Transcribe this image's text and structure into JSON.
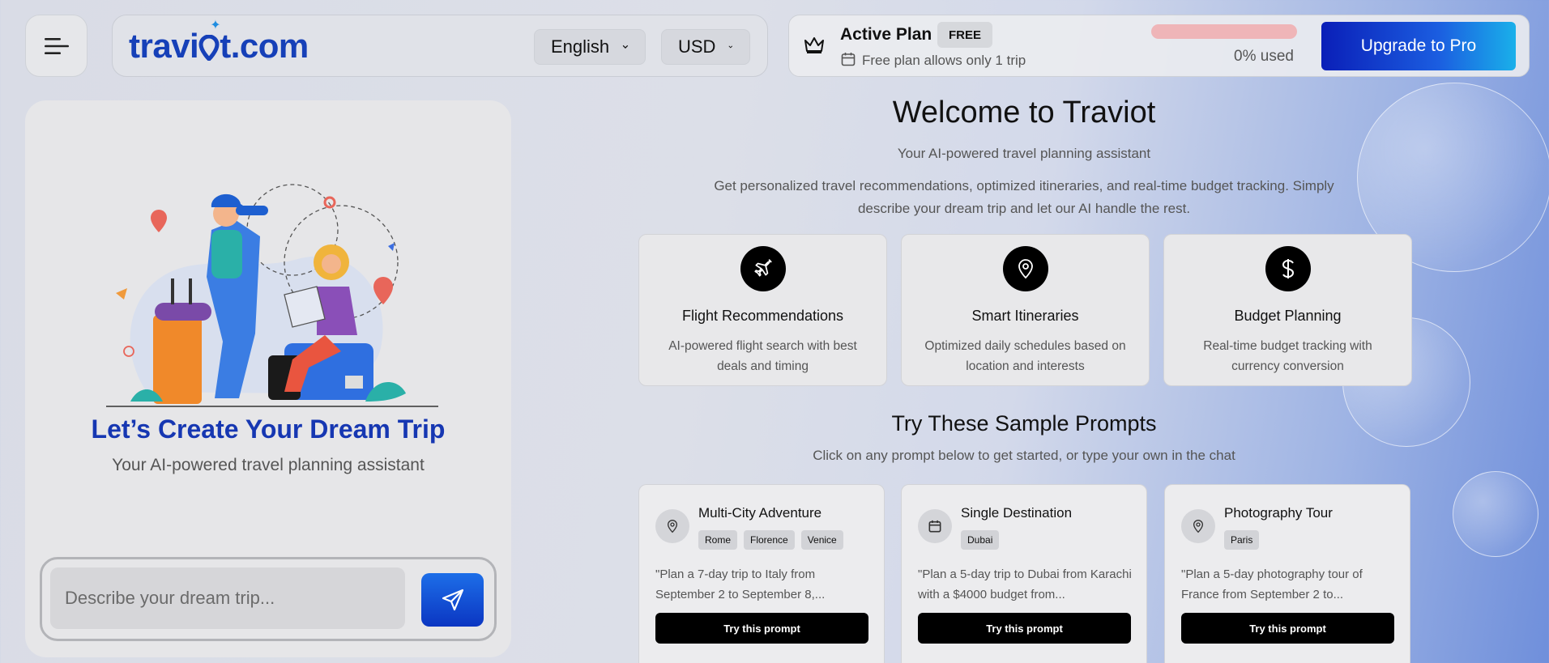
{
  "header": {
    "logo_text": "travi",
    "logo_suffix": "t.com",
    "language": "English",
    "currency": "USD"
  },
  "plan": {
    "title": "Active Plan",
    "badge": "FREE",
    "subtitle": "Free plan allows only 1 trip",
    "usage_percent": 0,
    "usage_label": "0% used",
    "upgrade_label": "Upgrade to Pro"
  },
  "left": {
    "title": "Let’s Create Your Dream Trip",
    "subtitle": "Your AI-powered travel planning assistant",
    "input_placeholder": "Describe your dream trip..."
  },
  "main": {
    "title": "Welcome to Traviot",
    "subtitle": "Your AI-powered travel planning assistant",
    "description": "Get personalized travel recommendations, optimized itineraries, and real-time budget tracking. Simply describe your dream trip and let our AI handle the rest.",
    "features": [
      {
        "icon": "plane-icon",
        "title": "Flight Recommendations",
        "desc": "AI-powered flight search with best deals and timing"
      },
      {
        "icon": "map-pin-icon",
        "title": "Smart Itineraries",
        "desc": "Optimized daily schedules based on location and interests"
      },
      {
        "icon": "dollar-icon",
        "title": "Budget Planning",
        "desc": "Real-time budget tracking with currency conversion"
      }
    ],
    "prompts_title": "Try These Sample Prompts",
    "prompts_sub": "Click on any prompt below to get started, or type your own in the chat",
    "prompts": [
      {
        "icon": "map-pin-icon",
        "title": "Multi-City Adventure",
        "tags": [
          "Rome",
          "Florence",
          "Venice"
        ],
        "text": "\"Plan a 7-day trip to Italy from September 2 to September 8,...",
        "button": "Try this prompt"
      },
      {
        "icon": "calendar-icon",
        "title": "Single Destination",
        "tags": [
          "Dubai"
        ],
        "text": "\"Plan a 5-day trip to Dubai from Karachi with a $4000 budget from...",
        "button": "Try this prompt"
      },
      {
        "icon": "map-pin-icon",
        "title": "Photography Tour",
        "tags": [
          "Paris"
        ],
        "text": "\"Plan a 5-day photography tour of France from September 2 to...",
        "button": "Try this prompt"
      }
    ]
  },
  "colors": {
    "brand": "#1640b8",
    "accent": "#0a1fb8",
    "progress_bg": "#efb5b8"
  }
}
